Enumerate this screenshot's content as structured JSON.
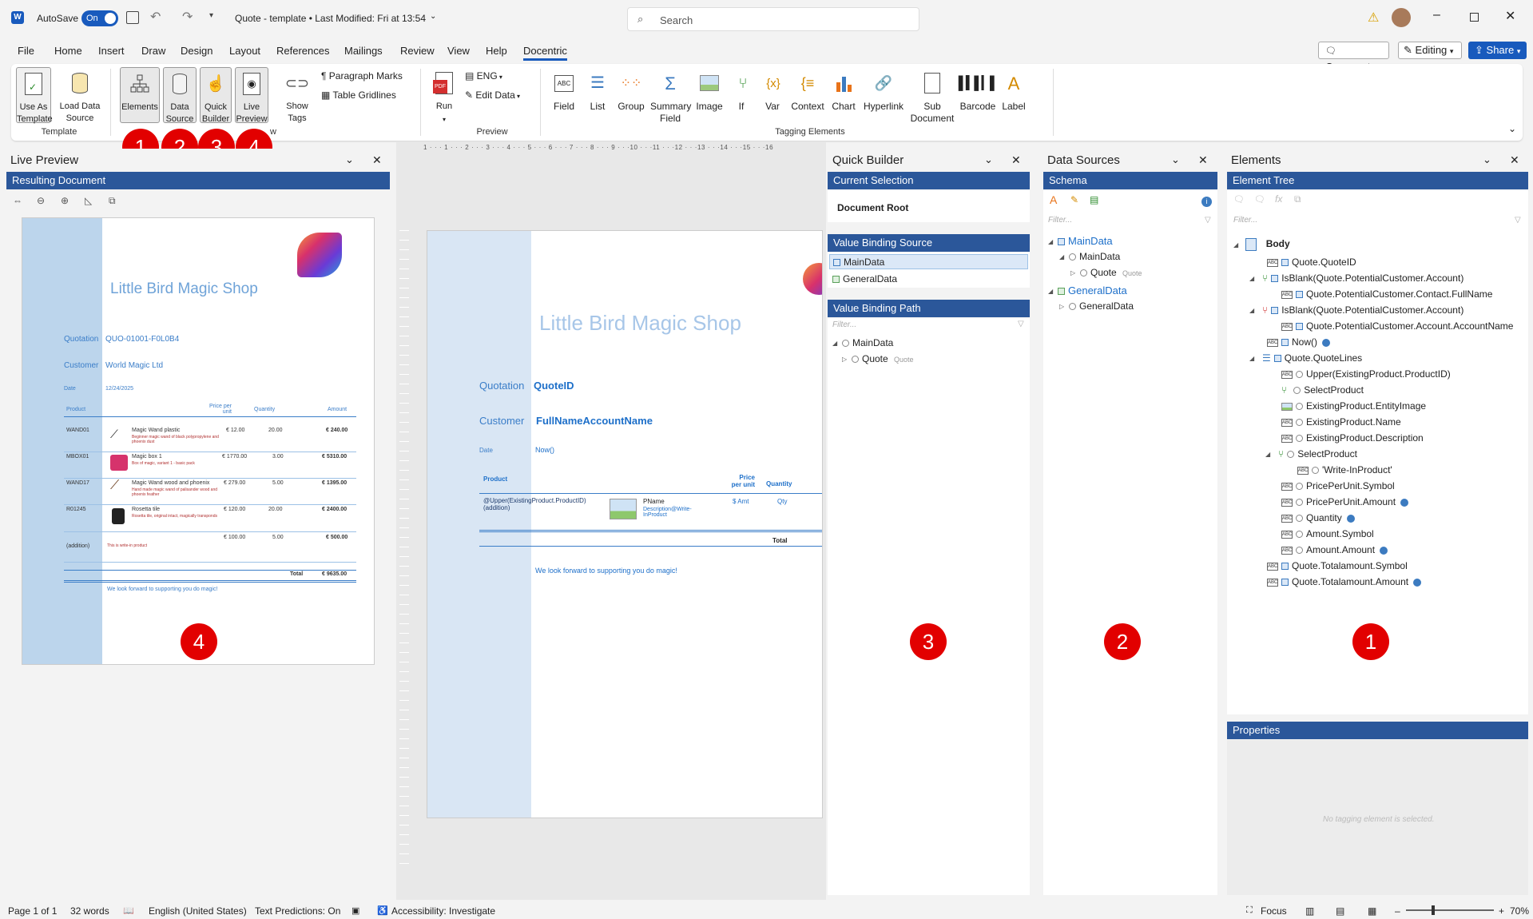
{
  "titlebar": {
    "autosave_label": "AutoSave",
    "autosave_state": "On",
    "document_title": "Quote - template  •  Last Modified: Fri at 13:54",
    "search_placeholder": "Search"
  },
  "menu": {
    "tabs": [
      "File",
      "Home",
      "Insert",
      "Draw",
      "Design",
      "Layout",
      "References",
      "Mailings",
      "Review",
      "View",
      "Help",
      "Docentric"
    ],
    "active_tab": "Docentric",
    "comments_label": "Comments",
    "editing_label": "Editing",
    "share_label": "Share"
  },
  "ribbon": {
    "use_as_template": "Use As Template",
    "load_data_source": "Load Data Source",
    "template_group": "Template",
    "elements": "Elements",
    "data_source": "Data Source",
    "quick_builder": "Quick Builder",
    "live_preview": "Live Preview",
    "view_group_fragment": "w",
    "show_tags": "Show Tags",
    "paragraph_marks": "Paragraph Marks",
    "table_gridlines": "Table Gridlines",
    "run": "Run",
    "lang": "ENG",
    "edit_data": "Edit Data",
    "preview_group": "Preview",
    "tagging": [
      "Field",
      "List",
      "Group",
      "Summary Field",
      "Image",
      "If",
      "Var",
      "Context",
      "Chart",
      "Hyperlink",
      "Sub Document",
      "Barcode",
      "Label"
    ],
    "tagging_group": "Tagging Elements",
    "callouts": [
      "1",
      "2",
      "3",
      "4"
    ]
  },
  "live_preview": {
    "title": "Live Preview",
    "bar": "Resulting Document",
    "shop_name": "Little Bird Magic Shop",
    "quotation_label": "Quotation",
    "quotation_value": "QUO-01001-F0L0B4",
    "customer_label": "Customer",
    "customer_value": "World Magic Ltd",
    "date_label": "Date",
    "date_value": "12/24/2025",
    "col_product": "Product",
    "col_price": "Price per unit",
    "col_qty": "Quantity",
    "col_amount": "Amount",
    "rows": [
      {
        "code": "WAND01",
        "name": "Magic Wand plastic",
        "desc": "Beginner magic wand of black polypropylene and phoenix dust",
        "price": "€ 12.00",
        "qty": "20.00",
        "amount": "€ 240.00"
      },
      {
        "code": "MBOX01",
        "name": "Magic box 1",
        "desc": "Box of magic, variant 1 - basic pack",
        "price": "€ 1770.00",
        "qty": "3.00",
        "amount": "€ 5310.00"
      },
      {
        "code": "WAND17",
        "name": "Magic Wand wood and phoenix",
        "desc": "Hand made magic wand of palisander wood and phoenix feather",
        "price": "€ 279.00",
        "qty": "5.00",
        "amount": "€ 1395.00"
      },
      {
        "code": "R01245",
        "name": "Rosetta tile",
        "desc": "Rosetta tile, original intact, magically transponds",
        "price": "€ 120.00",
        "qty": "20.00",
        "amount": "€ 2400.00"
      },
      {
        "code": "(addition)",
        "name": "",
        "desc": "This is write-in product",
        "price": "€ 100.00",
        "qty": "5.00",
        "amount": "€ 500.00"
      }
    ],
    "total_label": "Total",
    "total_value": "€ 9635.00",
    "footer": "We look forward to supporting you do magic!",
    "callout": "4"
  },
  "ruler": {
    "labels": "1 · · · 1 · · · 2 · · · 3 · · · 4 · · · 5 · · · 6 · · · 7 · · · 8 · · · 9 · · ·10 · · ·11 · · ·12 · · ·13 · · ·14 · · ·15 · · ·16"
  },
  "document": {
    "shop_name": "Little Bird Magic Shop",
    "quotation_label": "Quotation",
    "quotation_tag": "QuoteID",
    "customer_label": "Customer",
    "customer_tag": "FullNameAccountName",
    "date_label": "Date",
    "date_tag": "Now()",
    "col_product": "Product",
    "col_price": "Price per unit",
    "col_qty": "Quantity",
    "row_code": "@Upper(ExistingProduct.ProductID) (addition)",
    "row_name": "PName",
    "row_desc": "Description@Write-InProduct",
    "row_amt": "$ Amt",
    "row_qty": "Qty",
    "total": "Total",
    "footer": "We look forward to supporting you do magic!"
  },
  "quick_builder": {
    "title": "Quick Builder",
    "current_selection": "Current Selection",
    "selection_value": "Document Root",
    "binding_source": "Value Binding Source",
    "sources": [
      "MainData",
      "GeneralData"
    ],
    "binding_path": "Value Binding Path",
    "filter_placeholder": "Filter...",
    "path_items": [
      "MainData",
      "Quote"
    ],
    "path_hint": "Quote",
    "callout": "3"
  },
  "data_sources": {
    "title": "Data Sources",
    "bar": "Schema",
    "filter_placeholder": "Filter...",
    "items": [
      "MainData",
      "MainData",
      "Quote",
      "GeneralData",
      "GeneralData"
    ],
    "quote_hint": "Quote",
    "callout": "2"
  },
  "elements": {
    "title": "Elements",
    "bar": "Element Tree",
    "filter_placeholder": "Filter...",
    "root": "Body",
    "items": [
      "Quote.QuoteID",
      "IsBlank(Quote.PotentialCustomer.Account)",
      "Quote.PotentialCustomer.Contact.FullName",
      "IsBlank(Quote.PotentialCustomer.Account)",
      "Quote.PotentialCustomer.Account.AccountName",
      "Now()",
      "Quote.QuoteLines",
      "Upper(ExistingProduct.ProductID)",
      "SelectProduct",
      "ExistingProduct.EntityImage",
      "ExistingProduct.Name",
      "ExistingProduct.Description",
      "SelectProduct",
      "'Write-InProduct'",
      "PricePerUnit.Symbol",
      "PricePerUnit.Amount",
      "Quantity",
      "Amount.Symbol",
      "Amount.Amount",
      "Quote.Totalamount.Symbol",
      "Quote.Totalamount.Amount"
    ],
    "properties": "Properties",
    "no_selection": "No tagging element is selected.",
    "callout": "1"
  },
  "status": {
    "page": "Page 1 of 1",
    "words": "32 words",
    "language": "English (United States)",
    "predictions": "Text Predictions: On",
    "accessibility": "Accessibility: Investigate",
    "focus": "Focus",
    "zoom": "70%"
  },
  "colors": {
    "accent": "#2b579a",
    "callout": "#e20000",
    "link": "#1d6fc9"
  }
}
